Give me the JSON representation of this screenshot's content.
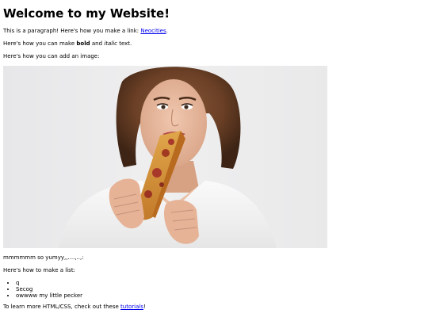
{
  "heading": "Welcome to my Website!",
  "para1": {
    "prefix": "This is a paragraph! Here's how you make a link: ",
    "link_text": "Neocities",
    "suffix": "."
  },
  "para2": {
    "prefix": "Here's how you can make ",
    "bold": "bold",
    "middle": " and ",
    "italic": "italic",
    "suffix": " text."
  },
  "para3": "Here's how you can add an image:",
  "image": {
    "alt": "woman eating pizza",
    "background": "#ececec"
  },
  "caption": "mmmmmm so yumyy,,....,..,:",
  "list_intro": "Here's how to make a list:",
  "list_items": [
    "q",
    "Secog",
    "owwww my little pecker"
  ],
  "footer": {
    "prefix": "To learn more HTML/CSS, check out these ",
    "link_text": "tutorials",
    "suffix": "!"
  },
  "colors": {
    "link": "#0000ee",
    "text": "#000000"
  }
}
